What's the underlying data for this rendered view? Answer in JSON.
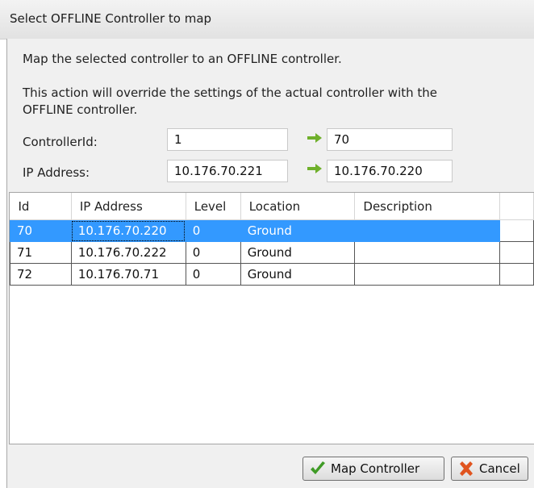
{
  "window": {
    "title": "Select OFFLINE Controller to map"
  },
  "message": {
    "line1": "Map the selected controller to an OFFLINE controller.",
    "line2": "This action will override the settings of the actual controller with the OFFLINE controller."
  },
  "form": {
    "controller_id_label": "ControllerId:",
    "controller_id_current": "1",
    "controller_id_target": "70",
    "ip_label": "IP Address:",
    "ip_current": "10.176.70.221",
    "ip_target": "10.176.70.220",
    "arrow_icon": "arrow-right-icon",
    "arrow_color": "#6fb02b"
  },
  "table": {
    "headers": [
      "Id",
      "IP Address",
      "Level",
      "Location",
      "Description"
    ],
    "rows": [
      {
        "id": "70",
        "ip": "10.176.70.220",
        "level": "0",
        "location": "Ground",
        "description": ""
      },
      {
        "id": "71",
        "ip": "10.176.70.222",
        "level": "0",
        "location": "Ground",
        "description": ""
      },
      {
        "id": "72",
        "ip": "10.176.70.71",
        "level": "0",
        "location": "Ground",
        "description": ""
      }
    ],
    "selected_row": "70",
    "selection_color": "#3399ff"
  },
  "buttons": {
    "map_label": "Map Controller",
    "map_icon": "checkmark-icon",
    "cancel_label": "Cancel",
    "cancel_icon": "x-icon"
  }
}
